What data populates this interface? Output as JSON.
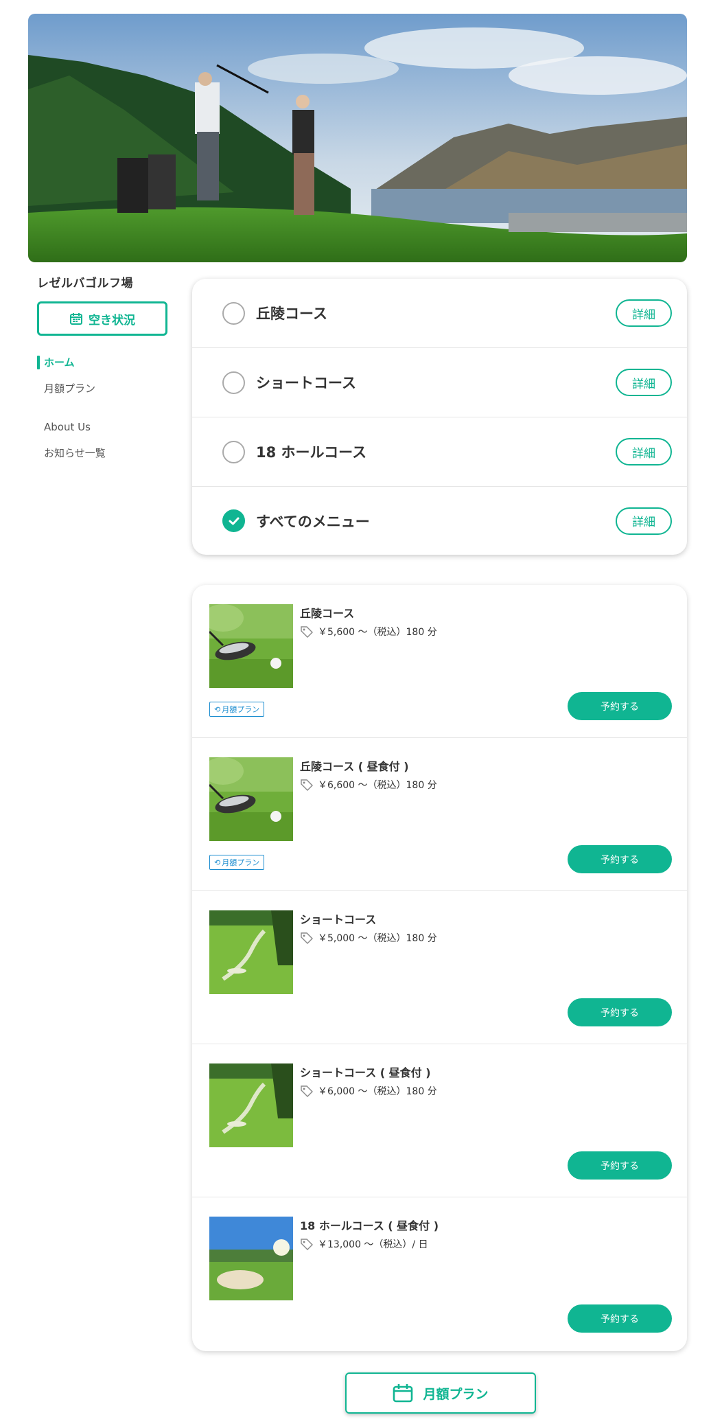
{
  "hero": {
    "image": "golfers-on-lakeside-course-photo"
  },
  "sidebar": {
    "site_name": "レゼルバゴルフ場",
    "availability_button": {
      "label": "空き状況",
      "icon": "calendar-icon"
    },
    "nav": [
      {
        "label": "ホーム",
        "active": true
      },
      {
        "label": "月額プラン",
        "active": false
      },
      {
        "label": "About Us",
        "active": false
      },
      {
        "label": "お知らせ一覧",
        "active": false
      }
    ]
  },
  "courses": [
    {
      "name": "丘陵コース",
      "checked": false,
      "detail_label": "詳細"
    },
    {
      "name": "ショートコース",
      "checked": false,
      "detail_label": "詳細"
    },
    {
      "name": "18 ホールコース",
      "checked": false,
      "detail_label": "詳細"
    },
    {
      "name": "すべてのメニュー",
      "checked": true,
      "detail_label": "詳細"
    }
  ],
  "menu": [
    {
      "title": "丘陵コース",
      "price": "￥5,600 〜（税込）180 分",
      "badge": "月額プラン",
      "reserve_label": "予約する",
      "thumb": "golf-driver-and-ball"
    },
    {
      "title": "丘陵コース ( 昼食付 )",
      "price": "￥6,600 〜（税込）180 分",
      "badge": "月額プラン",
      "reserve_label": "予約する",
      "thumb": "golf-driver-and-ball"
    },
    {
      "title": "ショートコース",
      "price": "￥5,000 〜（税込）180 分",
      "badge": null,
      "reserve_label": "予約する",
      "thumb": "fairway-with-bunkers"
    },
    {
      "title": "ショートコース ( 昼食付 )",
      "price": "￥6,000 〜（税込）180 分",
      "badge": null,
      "reserve_label": "予約する",
      "thumb": "fairway-with-bunkers"
    },
    {
      "title": "18 ホールコース ( 昼食付 )",
      "price": "￥13,000 〜（税込）/ 日",
      "badge": null,
      "reserve_label": "予約する",
      "thumb": "sunny-course-with-bunker"
    }
  ],
  "bottom_button": {
    "label": "月額プラン",
    "icon": "calendar-icon"
  },
  "colors": {
    "accent": "#10b592",
    "badge": "#1a8ccf"
  }
}
